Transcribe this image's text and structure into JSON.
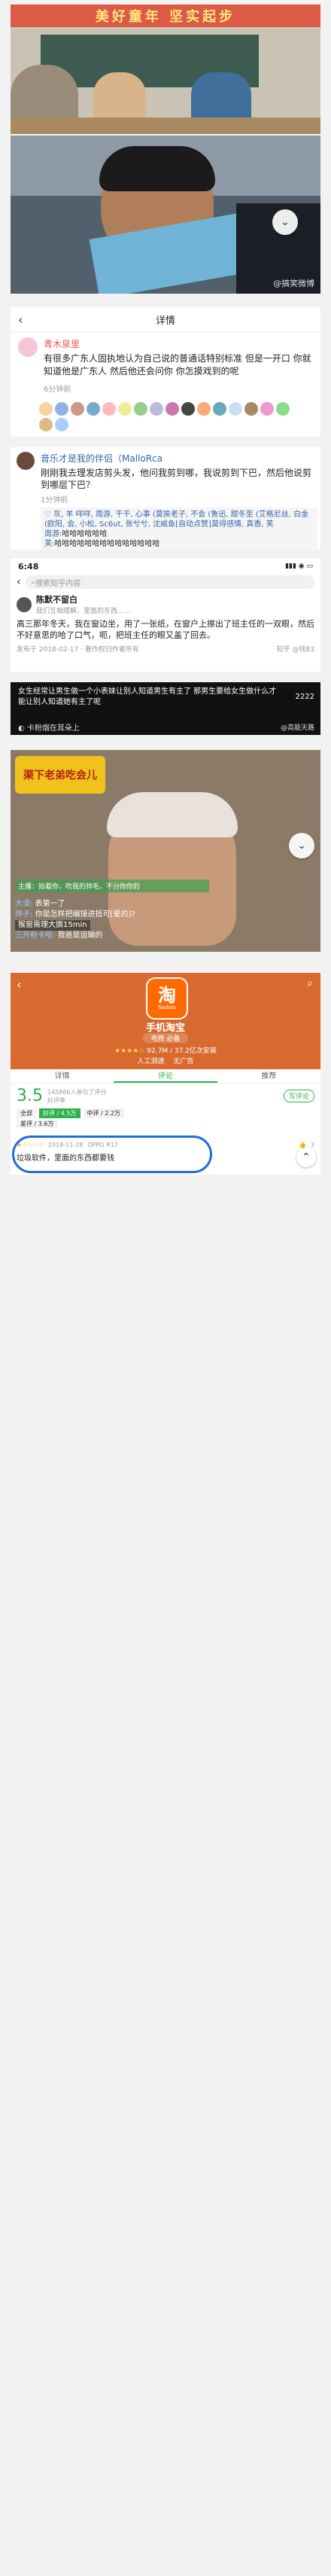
{
  "banner": {
    "text": "美好童年 坚实起步"
  },
  "photo1": {
    "watermark": "@搞笑微博"
  },
  "detail_header": {
    "title": "详情"
  },
  "post1": {
    "username": "青木泉里",
    "body": "有很多广东人固执地认为自己说的普通话特别标准 但是一开口 你就知道他是广东人 然后他还会问你 你怎摸戏到的呢",
    "time": "6分钟前"
  },
  "post2": {
    "username": "音乐才是我的伴侣（MalloRca",
    "body": "刚刚我去理发店剪头发，他问我剪到哪，我说剪到下巴，然后他说剪到哪层下巴？",
    "time": "1分钟前",
    "comment1": "♡ 灰, 羊 咩咩, 周游, 干干, 心事 (莫挨老子, 不会 (鲁迅, 甜冬至 (艾格尼丝, 白金 (欧阳, 会, 小松, Sc6ut, 张兮兮, 沈威鱼[自动点赞]莫得感情, 真香, 芙",
    "comment2_name": "周游:",
    "comment2_text": "哈哈哈哈哈哈",
    "comment3_name": "芙:",
    "comment3_text": "哈哈哈哈哈哈哈哈哈哈哈哈哈哈"
  },
  "phone": {
    "time": "6:48",
    "search_placeholder": "搜索知乎内容",
    "username": "陈默不留白",
    "subtitle": "我们互相理解，里面的东西……",
    "body": "高三那年冬天，我在窗边坐，用了一张纸，在窗户上擦出了班主任的一双眼，然后不好意思的哈了口气，呃，把班主任的眼又盖了回去。",
    "date": "发布于 2018-02-17 · 著作权归作者所有",
    "source": "知乎 @钱83"
  },
  "video1": {
    "caption": "女生经常让男生做一个小表妹让别人知道男生有主了 那男生要给女生做什么才能让别人知道她有主了呢",
    "hint": "卡粉烟在耳朵上",
    "count": "2222",
    "watermark": "@高能天路"
  },
  "video2": {
    "banner": "渠下老弟吃会儿",
    "blur1": "主播：拍着你，吹我的帅毛，不分你你的",
    "user1": "大漠:",
    "text1": "表第一了",
    "user2": "烨子:",
    "text2": "你是怎样把编接进抵可[星的]?",
    "gift1": "猴窗需理大旗15min",
    "user3": "三开粉卡哈:",
    "text3": "我爸是运输的"
  },
  "app": {
    "name": "手机淘宝",
    "logo_char": "淘",
    "logo_sub": "Taobao",
    "tag": "电商 必备",
    "rating_text": "92.7M / 37.2亿次安装",
    "badge1": "人工测速",
    "badge2": "无广告"
  },
  "tabs": {
    "tab1": "详情",
    "tab2": "评论",
    "tab3": "推荐"
  },
  "rating": {
    "score": "3.5",
    "stars_count": "145866人参与了评分",
    "sub": "好评率",
    "button": "写评论",
    "filter_all": "全部",
    "filter_good": "好评 / 4.5万",
    "filter_mid": "中评 / 2.2万",
    "filter_bad": "差评 / 3.6万"
  },
  "review": {
    "date": "2018-11-28",
    "device": "OPPO R17",
    "text": "垃圾软件，里面的东西都要钱",
    "likes": "3"
  },
  "colors": {
    "taobao_orange": "#ff6a00",
    "green": "#2bb24c",
    "blue_circle": "#1e6fd9"
  }
}
